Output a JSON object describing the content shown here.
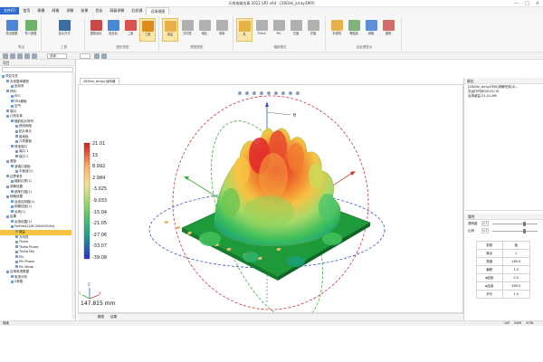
{
  "app": {
    "title": "天线电磁仿真 2022 SP2 x64 - [28GHz_array.EMX]",
    "window_controls": [
      "—",
      "□",
      "×"
    ]
  },
  "menu": {
    "items": [
      "文件(F)",
      "首页",
      "建模",
      "网格",
      "求解",
      "结果",
      "优化",
      "高级求解",
      "后处理",
      "远场视图"
    ]
  },
  "ribbon": {
    "groups": [
      {
        "label": "导出",
        "buttons": [
          "导出数据",
          "导入数据"
        ]
      },
      {
        "label": "工具",
        "buttons": [
          "显示方式"
        ]
      },
      {
        "label": "图形类型",
        "buttons": [
          "直角坐标",
          "极坐标",
          "二维",
          "三维"
        ]
      },
      {
        "label": "数据类型",
        "buttons": [
          "增益",
          "方向性",
          "轴比",
          "电场"
        ]
      },
      {
        "label": "辐射模式",
        "buttons": [
          "总",
          "Theta",
          "Phi",
          "左旋",
          "右旋"
        ]
      },
      {
        "label": "后处理显示",
        "buttons": [
          "半透明",
          "等值线",
          "网格",
          "图例"
        ]
      }
    ]
  },
  "toolrow": {
    "layer_select": "总体",
    "domain_select": "第一频点"
  },
  "left_panel": {
    "title": "项目",
    "tree": [
      {
        "label": "项目文件",
        "level": 0
      },
      {
        "label": "天线整体模型",
        "level": 1
      },
      {
        "label": "坐标系",
        "level": 2
      },
      {
        "label": "材料",
        "level": 1
      },
      {
        "label": "PEC",
        "level": 2
      },
      {
        "label": "FR4基板",
        "level": 2
      },
      {
        "label": "空气",
        "level": 2
      },
      {
        "label": "端口",
        "level": 1
      },
      {
        "label": "几何实体",
        "level": 1
      },
      {
        "label": "辐射贴片阵列",
        "level": 2
      },
      {
        "label": "馈线网络",
        "level": 3
      },
      {
        "label": "贴片单元",
        "level": 3
      },
      {
        "label": "接地板",
        "level": 3
      },
      {
        "label": "介质基板",
        "level": 3
      },
      {
        "label": "馈电端口",
        "level": 2
      },
      {
        "label": "端口 1",
        "level": 3
      },
      {
        "label": "端口 2",
        "level": 3
      },
      {
        "label": "激励",
        "level": 1
      },
      {
        "label": "波端口激励",
        "level": 2
      },
      {
        "label": "平面波(1)",
        "level": 3
      },
      {
        "label": "边界条件",
        "level": 1
      },
      {
        "label": "辐射边界(1)",
        "level": 2
      },
      {
        "label": "求解设置",
        "level": 1
      },
      {
        "label": "频率扫描(1)",
        "level": 2
      },
      {
        "label": "网格设置",
        "level": 1
      },
      {
        "label": "自适应网格(1)",
        "level": 2
      },
      {
        "label": "网格加密(1)",
        "level": 2
      },
      {
        "label": "远场(1)",
        "level": 2
      },
      {
        "label": "结果",
        "level": 1
      },
      {
        "label": "远场设置(1)",
        "level": 2
      },
      {
        "label": "FarField1[28.000000GHz]",
        "level": 2
      },
      {
        "label": "增益",
        "level": 3,
        "highlighted": true
      },
      {
        "label": "方向性",
        "level": 3
      },
      {
        "label": "Theta",
        "level": 3
      },
      {
        "label": "Theta Phase",
        "level": 3
      },
      {
        "label": "Theta Mix",
        "level": 3
      },
      {
        "label": "Phi",
        "level": 3
      },
      {
        "label": "Phi Phase",
        "level": 3
      },
      {
        "label": "Phi Mode",
        "level": 3
      },
      {
        "label": "近场电场数据",
        "level": 1
      },
      {
        "label": "电场分布",
        "level": 2
      },
      {
        "label": "S参数",
        "level": 2
      }
    ]
  },
  "view": {
    "tab_label": "28GHz_array(远场增益)",
    "scale_text": "147.815 mm",
    "axis_labels": {
      "x": "X",
      "y": "Y",
      "z": "Z",
      "theta": "θ",
      "phi": "φ"
    }
  },
  "legend": {
    "values": [
      "21.01",
      "15",
      "8.992",
      "2.984",
      "-3.025",
      "-9.033",
      "-15.04",
      "-21.05",
      "-27.06",
      "-33.07",
      "-39.08"
    ],
    "colors": [
      "#d7191c",
      "#f46d43",
      "#fdae61",
      "#fee08b",
      "#d9ef8b",
      "#a6d96a",
      "#4dc36b",
      "#1a9f8a",
      "#2b83ba",
      "#3b5fd9",
      "#2b2bd6"
    ]
  },
  "bottom_tabs": [
    "模型",
    "结果"
  ],
  "output_panel": {
    "title": "输出",
    "lines": [
      "[28GHz_array.EMX]求解完成(4)...",
      "总运行时间:00:02:15",
      "远场增益:21.01 dBi"
    ]
  },
  "properties": {
    "title": "属性",
    "sliders": [
      {
        "label": "透明度",
        "value": "0.7",
        "frac": 0.7
      },
      {
        "label": "比例",
        "value": "0.7",
        "frac": 0.7
      }
    ],
    "rows": [
      [
        "参数",
        "值"
      ],
      [
        "频点",
        "1"
      ],
      [
        "角度",
        "180.0"
      ],
      [
        "偏移",
        "1.0"
      ],
      [
        "φ起始",
        "0.0"
      ],
      [
        "φ结束",
        "360.0"
      ],
      [
        "步长",
        "1.0"
      ]
    ]
  },
  "status": {
    "left": "就绪",
    "right": [
      "CAP",
      "NUM",
      "SCRL"
    ]
  }
}
